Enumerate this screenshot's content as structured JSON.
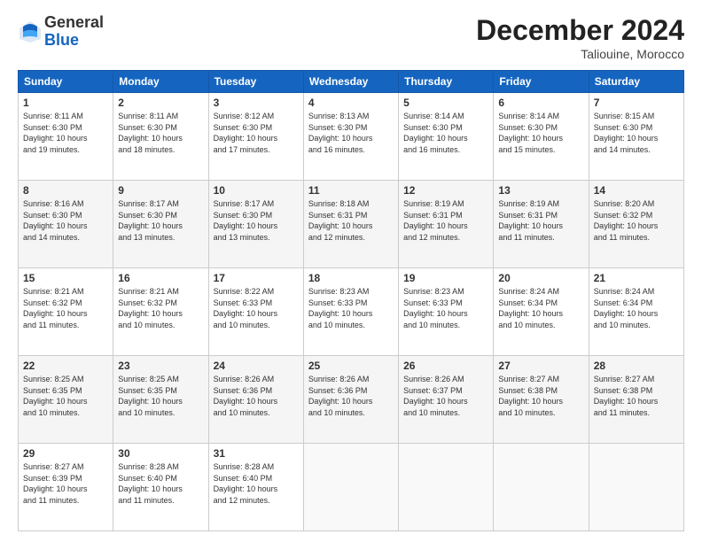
{
  "header": {
    "logo_general": "General",
    "logo_blue": "Blue",
    "title": "December 2024",
    "location": "Taliouine, Morocco"
  },
  "columns": [
    "Sunday",
    "Monday",
    "Tuesday",
    "Wednesday",
    "Thursday",
    "Friday",
    "Saturday"
  ],
  "weeks": [
    [
      {
        "day": "1",
        "lines": [
          "Sunrise: 8:11 AM",
          "Sunset: 6:30 PM",
          "Daylight: 10 hours",
          "and 19 minutes."
        ]
      },
      {
        "day": "2",
        "lines": [
          "Sunrise: 8:11 AM",
          "Sunset: 6:30 PM",
          "Daylight: 10 hours",
          "and 18 minutes."
        ]
      },
      {
        "day": "3",
        "lines": [
          "Sunrise: 8:12 AM",
          "Sunset: 6:30 PM",
          "Daylight: 10 hours",
          "and 17 minutes."
        ]
      },
      {
        "day": "4",
        "lines": [
          "Sunrise: 8:13 AM",
          "Sunset: 6:30 PM",
          "Daylight: 10 hours",
          "and 16 minutes."
        ]
      },
      {
        "day": "5",
        "lines": [
          "Sunrise: 8:14 AM",
          "Sunset: 6:30 PM",
          "Daylight: 10 hours",
          "and 16 minutes."
        ]
      },
      {
        "day": "6",
        "lines": [
          "Sunrise: 8:14 AM",
          "Sunset: 6:30 PM",
          "Daylight: 10 hours",
          "and 15 minutes."
        ]
      },
      {
        "day": "7",
        "lines": [
          "Sunrise: 8:15 AM",
          "Sunset: 6:30 PM",
          "Daylight: 10 hours",
          "and 14 minutes."
        ]
      }
    ],
    [
      {
        "day": "8",
        "lines": [
          "Sunrise: 8:16 AM",
          "Sunset: 6:30 PM",
          "Daylight: 10 hours",
          "and 14 minutes."
        ]
      },
      {
        "day": "9",
        "lines": [
          "Sunrise: 8:17 AM",
          "Sunset: 6:30 PM",
          "Daylight: 10 hours",
          "and 13 minutes."
        ]
      },
      {
        "day": "10",
        "lines": [
          "Sunrise: 8:17 AM",
          "Sunset: 6:30 PM",
          "Daylight: 10 hours",
          "and 13 minutes."
        ]
      },
      {
        "day": "11",
        "lines": [
          "Sunrise: 8:18 AM",
          "Sunset: 6:31 PM",
          "Daylight: 10 hours",
          "and 12 minutes."
        ]
      },
      {
        "day": "12",
        "lines": [
          "Sunrise: 8:19 AM",
          "Sunset: 6:31 PM",
          "Daylight: 10 hours",
          "and 12 minutes."
        ]
      },
      {
        "day": "13",
        "lines": [
          "Sunrise: 8:19 AM",
          "Sunset: 6:31 PM",
          "Daylight: 10 hours",
          "and 11 minutes."
        ]
      },
      {
        "day": "14",
        "lines": [
          "Sunrise: 8:20 AM",
          "Sunset: 6:32 PM",
          "Daylight: 10 hours",
          "and 11 minutes."
        ]
      }
    ],
    [
      {
        "day": "15",
        "lines": [
          "Sunrise: 8:21 AM",
          "Sunset: 6:32 PM",
          "Daylight: 10 hours",
          "and 11 minutes."
        ]
      },
      {
        "day": "16",
        "lines": [
          "Sunrise: 8:21 AM",
          "Sunset: 6:32 PM",
          "Daylight: 10 hours",
          "and 10 minutes."
        ]
      },
      {
        "day": "17",
        "lines": [
          "Sunrise: 8:22 AM",
          "Sunset: 6:33 PM",
          "Daylight: 10 hours",
          "and 10 minutes."
        ]
      },
      {
        "day": "18",
        "lines": [
          "Sunrise: 8:23 AM",
          "Sunset: 6:33 PM",
          "Daylight: 10 hours",
          "and 10 minutes."
        ]
      },
      {
        "day": "19",
        "lines": [
          "Sunrise: 8:23 AM",
          "Sunset: 6:33 PM",
          "Daylight: 10 hours",
          "and 10 minutes."
        ]
      },
      {
        "day": "20",
        "lines": [
          "Sunrise: 8:24 AM",
          "Sunset: 6:34 PM",
          "Daylight: 10 hours",
          "and 10 minutes."
        ]
      },
      {
        "day": "21",
        "lines": [
          "Sunrise: 8:24 AM",
          "Sunset: 6:34 PM",
          "Daylight: 10 hours",
          "and 10 minutes."
        ]
      }
    ],
    [
      {
        "day": "22",
        "lines": [
          "Sunrise: 8:25 AM",
          "Sunset: 6:35 PM",
          "Daylight: 10 hours",
          "and 10 minutes."
        ]
      },
      {
        "day": "23",
        "lines": [
          "Sunrise: 8:25 AM",
          "Sunset: 6:35 PM",
          "Daylight: 10 hours",
          "and 10 minutes."
        ]
      },
      {
        "day": "24",
        "lines": [
          "Sunrise: 8:26 AM",
          "Sunset: 6:36 PM",
          "Daylight: 10 hours",
          "and 10 minutes."
        ]
      },
      {
        "day": "25",
        "lines": [
          "Sunrise: 8:26 AM",
          "Sunset: 6:36 PM",
          "Daylight: 10 hours",
          "and 10 minutes."
        ]
      },
      {
        "day": "26",
        "lines": [
          "Sunrise: 8:26 AM",
          "Sunset: 6:37 PM",
          "Daylight: 10 hours",
          "and 10 minutes."
        ]
      },
      {
        "day": "27",
        "lines": [
          "Sunrise: 8:27 AM",
          "Sunset: 6:38 PM",
          "Daylight: 10 hours",
          "and 10 minutes."
        ]
      },
      {
        "day": "28",
        "lines": [
          "Sunrise: 8:27 AM",
          "Sunset: 6:38 PM",
          "Daylight: 10 hours",
          "and 11 minutes."
        ]
      }
    ],
    [
      {
        "day": "29",
        "lines": [
          "Sunrise: 8:27 AM",
          "Sunset: 6:39 PM",
          "Daylight: 10 hours",
          "and 11 minutes."
        ]
      },
      {
        "day": "30",
        "lines": [
          "Sunrise: 8:28 AM",
          "Sunset: 6:40 PM",
          "Daylight: 10 hours",
          "and 11 minutes."
        ]
      },
      {
        "day": "31",
        "lines": [
          "Sunrise: 8:28 AM",
          "Sunset: 6:40 PM",
          "Daylight: 10 hours",
          "and 12 minutes."
        ]
      },
      null,
      null,
      null,
      null
    ]
  ]
}
